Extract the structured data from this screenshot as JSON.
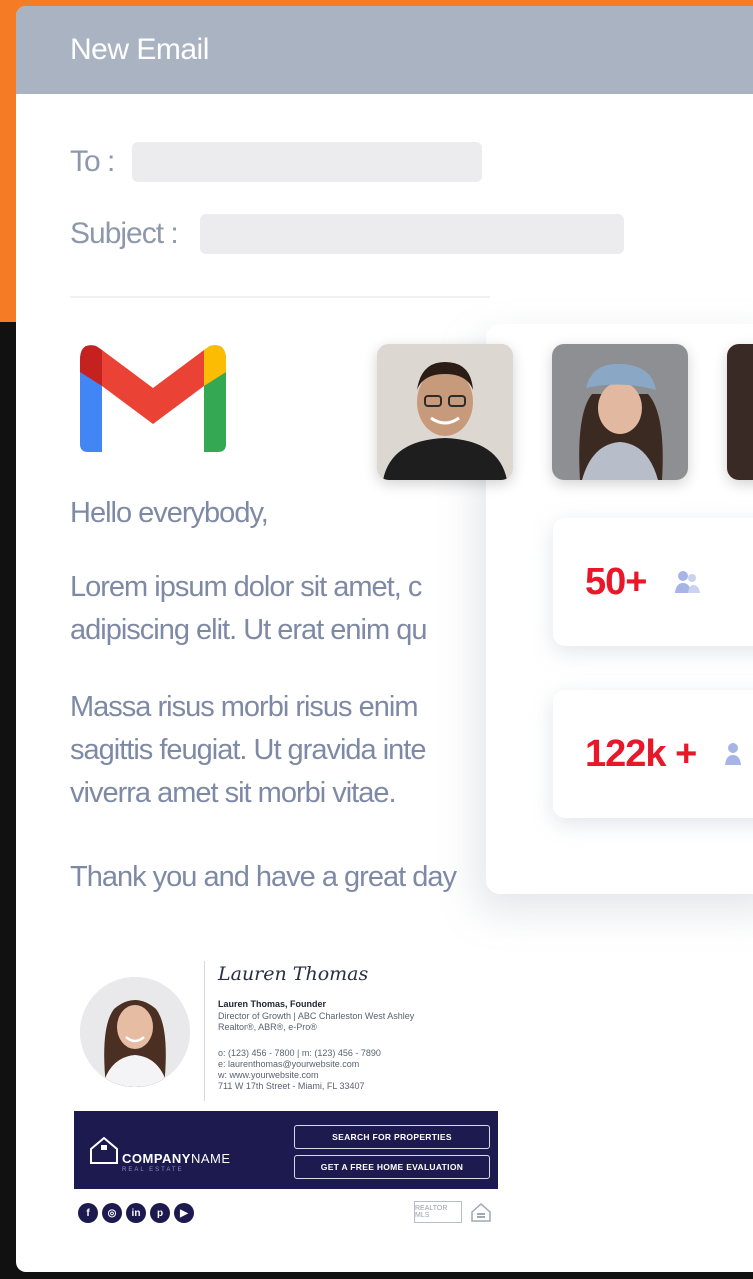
{
  "window": {
    "title": "New Email"
  },
  "compose": {
    "to_label": "To :",
    "to_value": "",
    "subject_label": "Subject :",
    "subject_value": ""
  },
  "email": {
    "greeting": "Hello everybody,",
    "paragraph1": [
      "Lorem ipsum dolor sit amet, c",
      "adipiscing elit. Ut erat enim qu"
    ],
    "paragraph2": [
      "Massa risus morbi risus enim",
      "sagittis feugiat. Ut gravida inte",
      "viverra amet sit morbi vitae."
    ],
    "closing": "Thank you and have a great day"
  },
  "stats": [
    {
      "value": "50+",
      "icon": "user-group-icon"
    },
    {
      "value": "122k +",
      "icon": "user-group-icon"
    }
  ],
  "signature": {
    "script_name": "Lauren Thomas",
    "name_line": "Lauren Thomas, Founder",
    "title_line1": "Director of Growth | ABC Charleston West Ashley",
    "title_line2": "Realtor®, ABR®, e-Pro®",
    "phone_line": "o: (123) 456 - 7800  |  m: (123) 456 - 7890",
    "email_line": "e: laurenthomas@yourwebsite.com",
    "web_line": "w: www.yourwebsite.com",
    "address_line": "711 W 17th Street - Miami, FL 33407",
    "company_bold": "COMPANY",
    "company_light": "NAME",
    "company_tag": "REAL ESTATE",
    "button1": "SEARCH FOR PROPERTIES",
    "button2": "GET A FREE HOME EVALUATION",
    "socials": [
      "f",
      "◎",
      "in",
      "p",
      "▶"
    ],
    "badge_text": "REALTOR MLS"
  },
  "colors": {
    "accent_red": "#e8182a",
    "titlebar": "#aab3c2",
    "banner": "#1c1a4f",
    "orange": "#f57c24"
  }
}
